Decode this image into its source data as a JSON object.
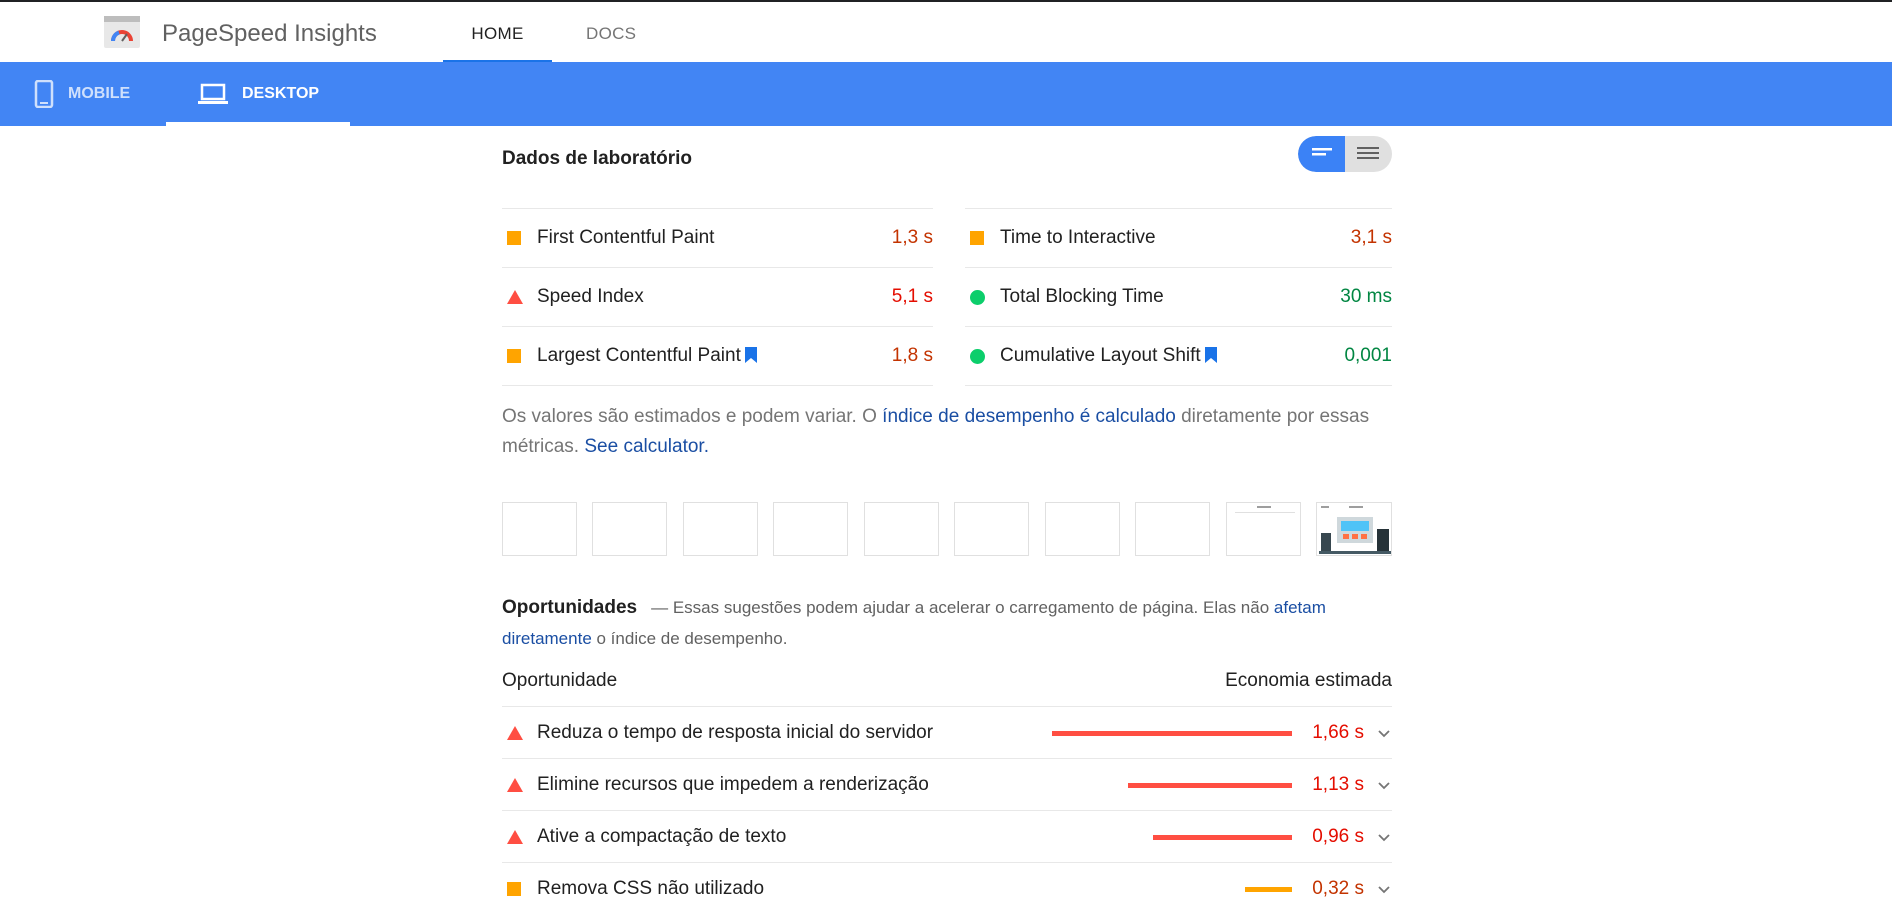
{
  "app": {
    "title": "PageSpeed Insights",
    "nav": [
      {
        "label": "HOME",
        "active": true
      },
      {
        "label": "DOCS",
        "active": false
      }
    ]
  },
  "device_tabs": [
    {
      "label": "MOBILE",
      "icon": "smartphone-icon",
      "active": false
    },
    {
      "label": "DESKTOP",
      "icon": "laptop-icon",
      "active": true
    }
  ],
  "lab": {
    "title": "Dados de laboratório",
    "metrics": [
      {
        "name": "First Contentful Paint",
        "value": "1,3 s",
        "status": "average",
        "bookmark": false
      },
      {
        "name": "Time to Interactive",
        "value": "3,1 s",
        "status": "average",
        "bookmark": false
      },
      {
        "name": "Speed Index",
        "value": "5,1 s",
        "status": "fail",
        "bookmark": false
      },
      {
        "name": "Total Blocking Time",
        "value": "30 ms",
        "status": "pass",
        "bookmark": false
      },
      {
        "name": "Largest Contentful Paint",
        "value": "1,8 s",
        "status": "average",
        "bookmark": true
      },
      {
        "name": "Cumulative Layout Shift",
        "value": "0,001",
        "status": "pass",
        "bookmark": true
      }
    ],
    "note_part1": "Os valores são estimados e podem variar. O ",
    "note_link1": "índice de desempenho é calculado",
    "note_part2": " diretamente por essas métricas. ",
    "note_link2": "See calculator."
  },
  "opportunities": {
    "title": "Oportunidades",
    "desc_part1": "— Essas sugestões podem ajudar a acelerar o carregamento de página. Elas não ",
    "desc_link": "afetam diretamente",
    "desc_part2": " o índice de desempenho.",
    "col_left": "Oportunidade",
    "col_right": "Economia estimada",
    "items": [
      {
        "name": "Reduza o tempo de resposta inicial do servidor",
        "saving": "1,66 s",
        "status": "fail",
        "bar_fraction": 1.0
      },
      {
        "name": "Elimine recursos que impedem a renderização",
        "saving": "1,13 s",
        "status": "fail",
        "bar_fraction": 0.68
      },
      {
        "name": "Ative a compactação de texto",
        "saving": "0,96 s",
        "status": "fail",
        "bar_fraction": 0.58
      },
      {
        "name": "Remova CSS não utilizado",
        "saving": "0,32 s",
        "status": "average",
        "bar_fraction": 0.19
      }
    ]
  },
  "colors": {
    "fail": "#e40d00",
    "fail_icon": "#ff4e42",
    "average": "#c33300",
    "average_icon": "#ffa400",
    "pass": "#018642",
    "pass_icon": "#0cce6b",
    "accent": "#4285f4",
    "link": "#1a4ea3"
  }
}
